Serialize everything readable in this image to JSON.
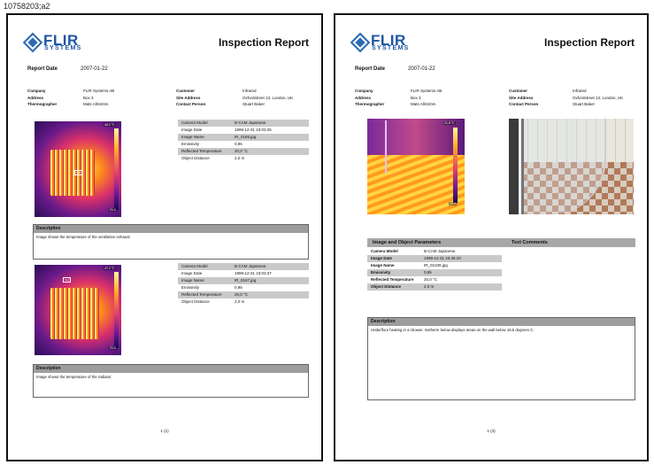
{
  "image_code": "10758203;a2",
  "page1": {
    "logo_text": "FLIR",
    "logo_sub": "SYSTEMS",
    "title": "Inspection Report",
    "report_date_label": "Report Date",
    "report_date": "2007-01-22",
    "left_info": [
      {
        "k": "Company",
        "v": "FLIR Systems AB"
      },
      {
        "k": "Address",
        "v": "Box 3"
      },
      {
        "k": "Thermographer",
        "v": "Mats Ahlström"
      }
    ],
    "right_info": [
      {
        "k": "Customer",
        "v": "Infrared"
      },
      {
        "k": "Site Address",
        "v": "Oxfordstreet 13, London, UK"
      },
      {
        "k": "Contact Person",
        "v": "Stuart Baker"
      }
    ],
    "image1": {
      "scale_top": "46.2 °C",
      "scale_bot": "21.0",
      "spot": "Sp1",
      "params": [
        {
          "k": "Camera Model",
          "v": "B-CAM Japanese."
        },
        {
          "k": "Image Date",
          "v": "1999-12-31 23:03:25"
        },
        {
          "k": "Image Name",
          "v": "IR_0165.jpg"
        },
        {
          "k": "Emissivity",
          "v": "0,95"
        },
        {
          "k": "Reflected Temperature",
          "v": "20,0 °C"
        },
        {
          "k": "Object Distance",
          "v": "2,0 m"
        }
      ],
      "desc_title": "Description",
      "desc_text": "Image shows the temperature of the ventilation exhaust."
    },
    "image2": {
      "scale_top": "47.2 °C",
      "scale_bot": "21.0",
      "spot": "Sp1",
      "params": [
        {
          "k": "Camera Model",
          "v": "B-CAM Japanese."
        },
        {
          "k": "Image Date",
          "v": "1999-12-31 23:03:37"
        },
        {
          "k": "Image Name",
          "v": "IR_0167.jpg"
        },
        {
          "k": "Emissivity",
          "v": "0,95"
        },
        {
          "k": "Reflected Temperature",
          "v": "20,0 °C"
        },
        {
          "k": "Object Distance",
          "v": "2,0 m"
        }
      ],
      "desc_title": "Description",
      "desc_text": "Image shows the temperature of the radiator."
    },
    "page_number": "1 (1)"
  },
  "page2": {
    "logo_text": "FLIR",
    "logo_sub": "SYSTEMS",
    "title": "Inspection Report",
    "report_date_label": "Report Date",
    "report_date": "2007-01-22",
    "left_info": [
      {
        "k": "Company",
        "v": "FLIR Systems AB"
      },
      {
        "k": "Address",
        "v": "Box 3"
      },
      {
        "k": "Thermographer",
        "v": "Mats Ahlström"
      }
    ],
    "right_info": [
      {
        "k": "Customer",
        "v": "Infrared"
      },
      {
        "k": "Site Address",
        "v": "Oxfordstreet 13, London, UK"
      },
      {
        "k": "Contact Person",
        "v": "Stuart Baker"
      }
    ],
    "scale_top": "21.8 °C",
    "scale_bot": "13.0",
    "params_header": "Image and Object Parameters",
    "comments_header": "Text Comments",
    "params": [
      {
        "k": "Camera Model",
        "v": "B-CAM Japanese."
      },
      {
        "k": "Image Date",
        "v": "1999-12-31 23:46:10"
      },
      {
        "k": "Image Name",
        "v": "IR_02109.jpg"
      },
      {
        "k": "Emissivity",
        "v": "0,95"
      },
      {
        "k": "Reflected Temperature",
        "v": "20,0 °C"
      },
      {
        "k": "Object Distance",
        "v": "2,0 m"
      }
    ],
    "desc_title": "Description",
    "desc_text": "Underfloor heating in a shower. Isotherm below displays areas on the wall below 16,5 degrees C.",
    "page_number": "1 (3)"
  }
}
